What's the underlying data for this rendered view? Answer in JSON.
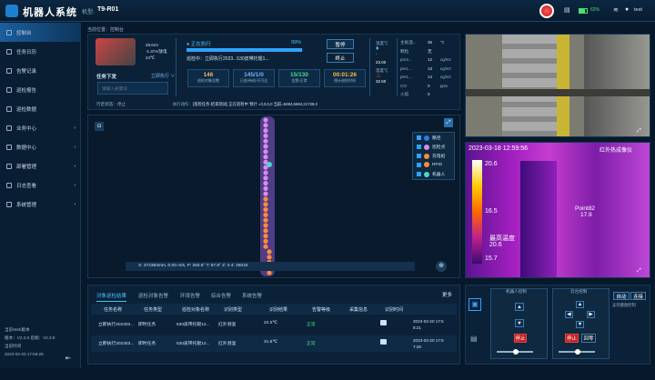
{
  "header": {
    "title": "机器人系统",
    "model_label": "机型:",
    "model": "T9-R01",
    "battery": "62%",
    "user": "test"
  },
  "sidebar": {
    "items": [
      {
        "label": "控制台",
        "active": true,
        "arrow": ""
      },
      {
        "label": "任务日历",
        "arrow": ""
      },
      {
        "label": "告警记录",
        "arrow": ""
      },
      {
        "label": "巡检报告",
        "arrow": ""
      },
      {
        "label": "巡检数据",
        "arrow": ""
      },
      {
        "label": "业务中心",
        "arrow": "›"
      },
      {
        "label": "数据中心",
        "arrow": "›"
      },
      {
        "label": "部署管理",
        "arrow": "›"
      },
      {
        "label": "日志查看",
        "arrow": "›"
      },
      {
        "label": "系统管理",
        "arrow": "›"
      }
    ],
    "version": {
      "l1": "当前Web版本",
      "l2": "版本：V2.3.9 后端：V2.3.8",
      "l3": "当前时间",
      "l4": "2023-03-20 17:59:28"
    }
  },
  "breadcrumb": "当前位置：控制台",
  "robot": {
    "temp": "29.61V",
    "speed": "-1.37A/放电",
    "env": "24℃",
    "task_label": "任务下发",
    "task_btn": "立即执行 ∨",
    "search_placeholder": "请输入关键词",
    "state_label": "行走状态：停止",
    "exec_label": "执行动作：",
    "exec_text": "[巡检任务-结束测试] 正在巡检中 预计 =0,0,0,0 当前=5694,5694,21739,0"
  },
  "task": {
    "status": "● 正在执行",
    "percent": "99%",
    "progress": 0.99,
    "desc": "巡检中：立即执行2023...530皮带托辊1...",
    "pause": "暂停",
    "stop": "终止",
    "stats": [
      {
        "value": "146",
        "label": "巡检对象总数",
        "color": "#f0b36a"
      },
      {
        "value": "145/1/0",
        "label": "已巡/待巡/不可达",
        "color": "#6fb7ff"
      },
      {
        "value": "15/130",
        "label": "告警/正常",
        "color": "#49e085"
      },
      {
        "value": "00:01:26",
        "label": "预计巡检时间",
        "color": "#ffbe3c"
      }
    ]
  },
  "env": {
    "temp_label": "温度℃",
    "temp": "-",
    "humid_label": "湿度%",
    "humid": "23.00",
    "t3_label": "温度℃",
    "t3": "32.50",
    "rows": [
      {
        "k": "主板温...",
        "v": "35",
        "u": "℃"
      },
      {
        "k": "颗粒",
        "v": "无",
        "u": ""
      },
      {
        "k": "pm2...",
        "v": "12",
        "u": "ug/m3"
      },
      {
        "k": "pm1...",
        "v": "13",
        "u": "ug/m3"
      },
      {
        "k": "pm1...",
        "v": "14",
        "u": "ug/m3"
      },
      {
        "k": "CO",
        "v": "0",
        "u": "ppm"
      },
      {
        "k": "火焰",
        "v": "0",
        "u": ""
      }
    ]
  },
  "map": {
    "legend": [
      "路径",
      "巡检点",
      "充电桩",
      "RFID",
      "机器人"
    ],
    "legend_colors": [
      "#2c7be5",
      "#d98af2",
      "#ff8b3d",
      "#ff8b3d",
      "#4fd6c4"
    ],
    "coords": "X: 272384mm,   0.00 m/s,   P: 283.6°   T: 67.8°   Z: 0   4: 26032"
  },
  "thermal": {
    "stamp": "2023-03-18 12:59:56",
    "title": "红外热成像仪",
    "max": "20.6",
    "mid": "16.5",
    "min": "15.7",
    "point": "Point82",
    "point_v": "17.9",
    "hi_label": "最高温度",
    "hi_v": "20.6"
  },
  "alerts": {
    "more": "更多",
    "tabs": [
      "对象巡检结果",
      "巡检对象告警",
      "环境告警",
      "综合告警",
      "系统告警"
    ],
    "headers": [
      "任务名称",
      "任务类型",
      "巡检对象名称",
      "识别类型",
      "识别结果",
      "告警等级",
      "采集信息",
      "识别时间"
    ],
    "rows": [
      {
        "name": "立即执行202303...",
        "type": "即时任务",
        "obj": "530皮带托辊12...",
        "rec": "红外测温",
        "res": "22.0℃",
        "level": "正常",
        "time": "2023-03-20 17:5\n8:21"
      },
      {
        "name": "立即执行202303...",
        "type": "即时任务",
        "obj": "530皮带托辊12...",
        "rec": "红外测温",
        "res": "21.6℃",
        "level": "正常",
        "time": "2023-03-20 17:5\n7:26"
      }
    ]
  },
  "ptz": {
    "left_title": "机器人控制",
    "right_title": "云台控制",
    "stop": "停止",
    "reset": "回零",
    "mode1": "自动",
    "mode2": "连接",
    "kb": "支持键盘控制"
  }
}
